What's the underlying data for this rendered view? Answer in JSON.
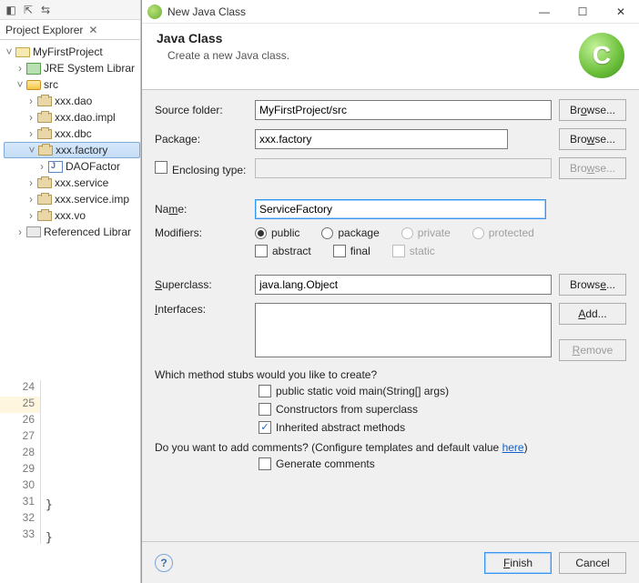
{
  "explorer": {
    "title": "Project Explorer",
    "project": "MyFirstProject",
    "jre": "JRE System Librar",
    "src": "src",
    "packages": [
      "xxx.dao",
      "xxx.dao.impl",
      "xxx.dbc",
      "xxx.factory",
      "DAOFactor",
      "xxx.service",
      "xxx.service.imp",
      "xxx.vo"
    ],
    "referenced": "Referenced Librar"
  },
  "gutter": {
    "start": 24,
    "end": 33,
    "highlight": 25
  },
  "braces": [
    "}",
    "}"
  ],
  "dialog": {
    "titlebar": "New Java Class",
    "banner_title": "Java Class",
    "banner_sub": "Create a new Java class.",
    "labels": {
      "source_folder": "Source folder:",
      "package": "Package:",
      "enclosing": "Enclosing type:",
      "name": "Name:",
      "modifiers": "Modifiers:",
      "superclass": "Superclass:",
      "interfaces": "Interfaces:"
    },
    "values": {
      "source_folder": "MyFirstProject/src",
      "package": "xxx.factory",
      "enclosing": "",
      "name": "ServiceFactory",
      "superclass": "java.lang.Object"
    },
    "buttons": {
      "browse": "Browse...",
      "add": "Add...",
      "remove": "Remove",
      "finish": "Finish",
      "cancel": "Cancel"
    },
    "modifiers_radio": {
      "public": "public",
      "package": "package",
      "private": "private",
      "protected": "protected"
    },
    "modifiers_check": {
      "abstract": "abstract",
      "final": "final",
      "static": "static"
    },
    "stub_question": "Which method stubs would you like to create?",
    "stubs": {
      "main": "public static void main(String[] args)",
      "constructors": "Constructors from superclass",
      "inherited": "Inherited abstract methods"
    },
    "comments_question_pre": "Do you want to add comments? (Configure templates and default value ",
    "comments_question_link": "here",
    "comments_question_post": ")",
    "generate_comments": "Generate comments"
  }
}
